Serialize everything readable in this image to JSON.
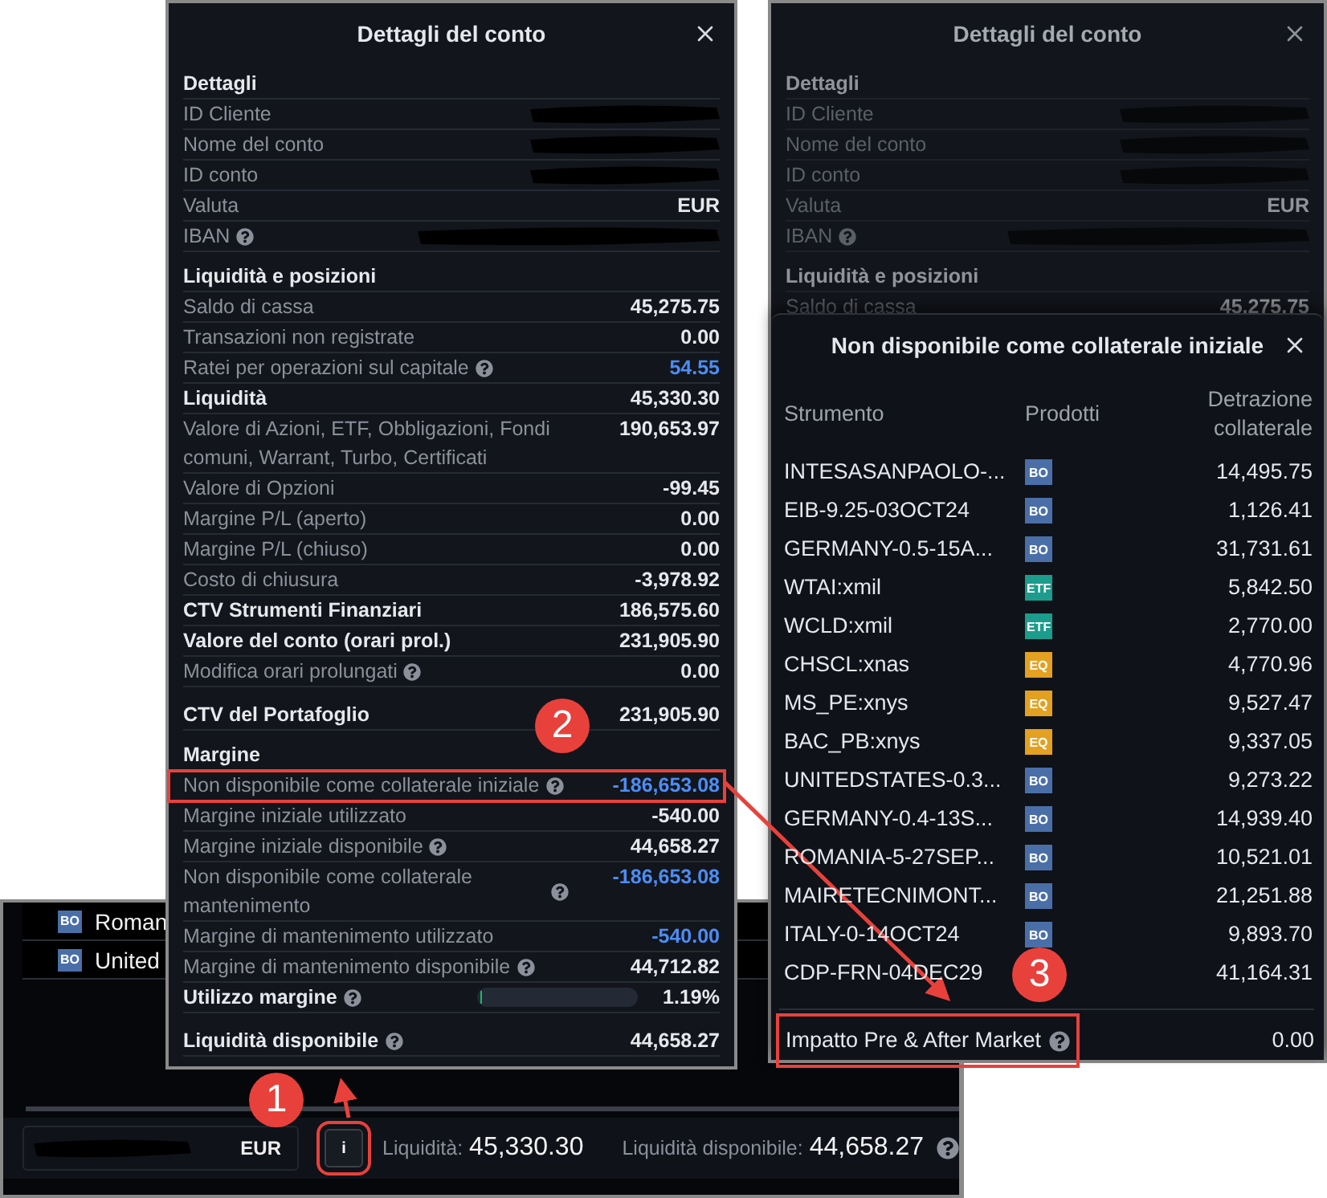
{
  "bottom_app": {
    "list": [
      {
        "badge": "BO",
        "color": "#4a6fa8",
        "name": "Roman"
      },
      {
        "badge": "BO",
        "color": "#4a6fa8",
        "name": "United"
      }
    ],
    "footer": {
      "account_redacted": true,
      "currency": "EUR",
      "info_button": {
        "label": "i",
        "marked": true
      },
      "cash_label": "Liquidità:",
      "cash_value": "45,330.30",
      "available_label": "Liquidità disponibile:",
      "available_value": "44,658.27",
      "help": true
    }
  },
  "left_panel": {
    "title": "Dettagli del conto",
    "rows": [
      {
        "kind": "section",
        "label": "Dettagli"
      },
      {
        "kind": "item",
        "label": "ID Cliente",
        "redacted": true
      },
      {
        "kind": "item",
        "label": "Nome del conto",
        "redacted": true
      },
      {
        "kind": "item",
        "label": "ID conto",
        "redacted": true
      },
      {
        "kind": "item",
        "label": "Valuta",
        "value": "EUR"
      },
      {
        "kind": "item",
        "label": "IBAN",
        "help": true,
        "redacted": true
      },
      {
        "kind": "section",
        "label": "Liquidità e posizioni"
      },
      {
        "kind": "item",
        "label": "Saldo di cassa",
        "value": "45,275.75"
      },
      {
        "kind": "item",
        "label": "Transazioni non registrate",
        "value": "0.00"
      },
      {
        "kind": "item",
        "label": "Ratei per operazioni sul capitale",
        "help": true,
        "value": "54.55",
        "accent": true
      },
      {
        "kind": "item",
        "label": "Liquidità",
        "value": "45,330.30",
        "strong": true
      },
      {
        "kind": "item",
        "label": "Valore di Azioni, ETF, Obbligazioni, Fondi comuni, Warrant, Turbo, Certificati",
        "value": "190,653.97"
      },
      {
        "kind": "item",
        "label": "Valore di Opzioni",
        "value": "-99.45"
      },
      {
        "kind": "item",
        "label": "Margine P/L (aperto)",
        "value": "0.00"
      },
      {
        "kind": "item",
        "label": "Margine P/L (chiuso)",
        "value": "0.00"
      },
      {
        "kind": "item",
        "label": "Costo di chiusura",
        "value": "-3,978.92"
      },
      {
        "kind": "item",
        "label": "CTV Strumenti Finanziari",
        "value": "186,575.60",
        "strong": true
      },
      {
        "kind": "item",
        "label": "Valore del conto (orari prol.)",
        "value": "231,905.90",
        "strong": true
      },
      {
        "kind": "item",
        "label": "Modifica orari prolungati",
        "help": true,
        "value": "0.00"
      },
      {
        "kind": "total",
        "label": "CTV del Portafoglio",
        "value": "231,905.90"
      },
      {
        "kind": "section",
        "label": "Margine"
      },
      {
        "kind": "item",
        "label": "Non disponibile come collaterale iniziale",
        "help": true,
        "value": "-186,653.08",
        "accent": true,
        "marked": true
      },
      {
        "kind": "item",
        "label": "Margine iniziale utilizzato",
        "value": "-540.00"
      },
      {
        "kind": "item",
        "label": "Margine iniziale disponibile",
        "help": true,
        "value": "44,658.27"
      },
      {
        "kind": "item",
        "label": "Non disponibile come collaterale mantenimento",
        "help": true,
        "value": "-186,653.08",
        "accent": true
      },
      {
        "kind": "item",
        "label": "Margine di mantenimento utilizzato",
        "value": "-540.00",
        "accent": true
      },
      {
        "kind": "item",
        "label": "Margine di mantenimento disponibile",
        "help": true,
        "value": "44,712.82"
      },
      {
        "kind": "bar",
        "label": "Utilizzo margine",
        "help": true,
        "level": 0.0119,
        "value": "1.19%"
      },
      {
        "kind": "total",
        "label": "Liquidità disponibile",
        "help": true,
        "value": "44,658.27"
      }
    ]
  },
  "right_panel": {
    "background": {
      "title": "Dettagli del conto",
      "rows": [
        {
          "kind": "section",
          "label": "Dettagli"
        },
        {
          "kind": "item",
          "label": "ID Cliente",
          "redacted": true
        },
        {
          "kind": "item",
          "label": "Nome del conto",
          "redacted": true
        },
        {
          "kind": "item",
          "label": "ID conto",
          "redacted": true
        },
        {
          "kind": "item",
          "label": "Valuta",
          "value": "EUR"
        },
        {
          "kind": "item",
          "label": "IBAN",
          "help": true,
          "redacted": true
        },
        {
          "kind": "section",
          "label": "Liquidità e posizioni"
        },
        {
          "kind": "item",
          "label": "Saldo di cassa",
          "value": "45,275.75"
        }
      ]
    },
    "sheet": {
      "title": "Non disponibile come collaterale iniziale",
      "columns": [
        "Strumento",
        "Prodotti",
        "Detrazione collaterale"
      ],
      "rows": [
        {
          "instrument": "INTESASANPAOLO-...",
          "product": "BO",
          "color": "#4a6fa8",
          "amount": "14,495.75"
        },
        {
          "instrument": "EIB-9.25-03OCT24",
          "product": "BO",
          "color": "#4a6fa8",
          "amount": "1,126.41"
        },
        {
          "instrument": "GERMANY-0.5-15A...",
          "product": "BO",
          "color": "#4a6fa8",
          "amount": "31,731.61"
        },
        {
          "instrument": "WTAI:xmil",
          "product": "ETF",
          "color": "#1b9c8c",
          "amount": "5,842.50"
        },
        {
          "instrument": "WCLD:xmil",
          "product": "ETF",
          "color": "#1b9c8c",
          "amount": "2,770.00"
        },
        {
          "instrument": "CHSCL:xnas",
          "product": "EQ",
          "color": "#e3a021",
          "amount": "4,770.96"
        },
        {
          "instrument": "MS_PE:xnys",
          "product": "EQ",
          "color": "#e3a021",
          "amount": "9,527.47"
        },
        {
          "instrument": "BAC_PB:xnys",
          "product": "EQ",
          "color": "#e3a021",
          "amount": "9,337.05"
        },
        {
          "instrument": "UNITEDSTATES-0.3...",
          "product": "BO",
          "color": "#4a6fa8",
          "amount": "9,273.22"
        },
        {
          "instrument": "GERMANY-0.4-13S...",
          "product": "BO",
          "color": "#4a6fa8",
          "amount": "14,939.40"
        },
        {
          "instrument": "ROMANIA-5-27SEP...",
          "product": "BO",
          "color": "#4a6fa8",
          "amount": "10,521.01"
        },
        {
          "instrument": "MAIRETECNIMONT...",
          "product": "BO",
          "color": "#4a6fa8",
          "amount": "21,251.88"
        },
        {
          "instrument": "ITALY-0-14OCT24",
          "product": "BO",
          "color": "#4a6fa8",
          "amount": "9,893.70"
        },
        {
          "instrument": "CDP-FRN-04DEC29",
          "amount": "41,164.31"
        }
      ],
      "footer": {
        "label": "Impatto Pre & After Market",
        "help": true,
        "value": "0.00",
        "marked": true
      }
    }
  },
  "annotations": [
    {
      "label": "1"
    },
    {
      "label": "2"
    },
    {
      "label": "3"
    }
  ]
}
